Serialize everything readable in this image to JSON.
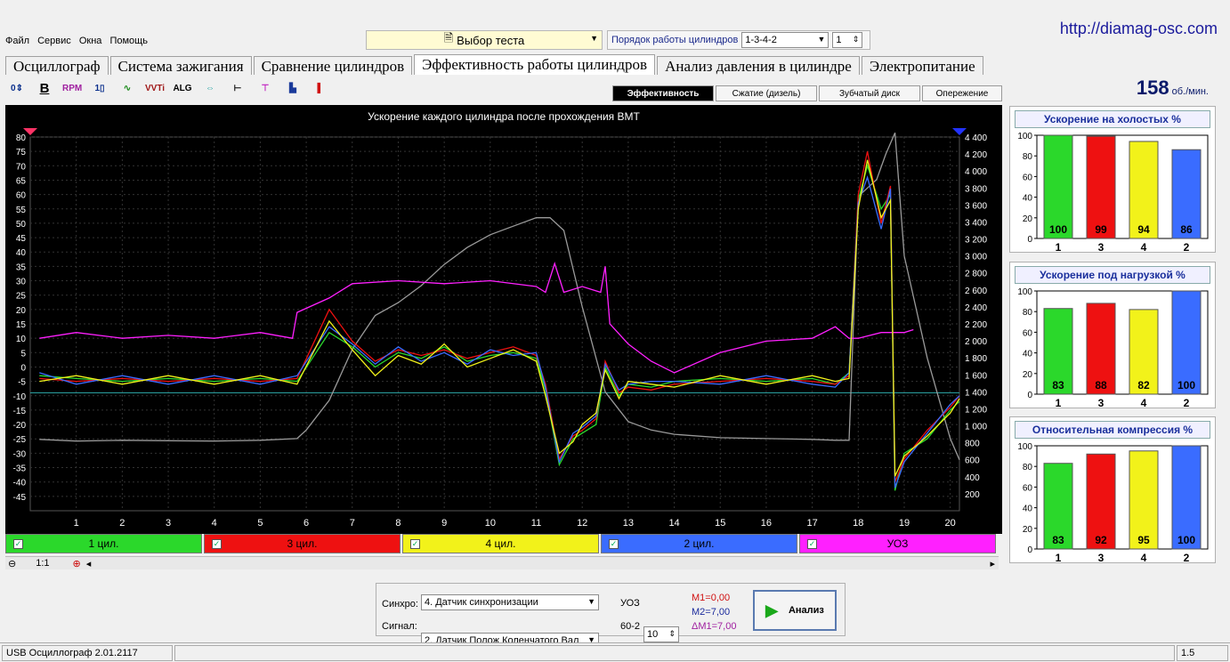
{
  "site_url": "http://diamag-osc.com",
  "menu": [
    "Файл",
    "Сервис",
    "Окна",
    "Помощь"
  ],
  "test_select": {
    "value": "Выбор теста"
  },
  "cyl_order": {
    "label": "Порядок работы цилиндров",
    "value": "1-3-4-2",
    "num": "1"
  },
  "tabs": [
    "Осциллограф",
    "Система зажигания",
    "Сравнение цилиндров",
    "Эффективность работы цилиндров",
    "Анализ давления в цилиндре",
    "Электропитание"
  ],
  "active_tab": 3,
  "subtabs": [
    "Эффективность",
    "Сжатие (дизель)",
    "Зубчатый диск",
    "Опережение"
  ],
  "rpm": {
    "value": "158",
    "unit": "об./мин."
  },
  "chart_title": "Ускорение каждого цилиндра после прохождения ВМТ",
  "colors": {
    "cyl1": "#2bd82b",
    "cyl3": "#ee1111",
    "cyl4": "#f2f21a",
    "cyl2": "#3a6cff",
    "uoz": "#ff20ff",
    "gray": "#9a9a9a",
    "ref": "#2aa0a0"
  },
  "legend": [
    {
      "label": "1 цил.",
      "color": "#2bd82b"
    },
    {
      "label": "3 цил.",
      "color": "#ee1111"
    },
    {
      "label": "4 цил.",
      "color": "#f2f21a"
    },
    {
      "label": "2 цил.",
      "color": "#3a6cff"
    },
    {
      "label": "УОЗ",
      "color": "#ff20ff"
    }
  ],
  "zoom_label": "1:1",
  "chart_data": {
    "type": "line",
    "title": "Ускорение каждого цилиндра после прохождения ВМТ",
    "x_ticks": [
      1,
      2,
      3,
      4,
      5,
      6,
      7,
      8,
      9,
      10,
      11,
      12,
      13,
      14,
      15,
      16,
      17,
      18,
      19,
      20
    ],
    "y_left_ticks": [
      80,
      75,
      70,
      65,
      60,
      55,
      50,
      45,
      40,
      35,
      30,
      25,
      20,
      15,
      10,
      5,
      0,
      -5,
      -10,
      -15,
      -20,
      -25,
      -30,
      -35,
      -40,
      -45
    ],
    "y_right_ticks": [
      "4 400",
      "4 200",
      "4 000",
      "3 800",
      "3 600",
      "3 400",
      "3 200",
      "3 000",
      "2 800",
      "2 600",
      "2 400",
      "2 200",
      "2 000",
      "1 800",
      "1 600",
      "1 400",
      "1 200",
      "1 000",
      "800",
      "600",
      "400",
      "200"
    ],
    "xlim": [
      0,
      20.2
    ],
    "ylim_left": [
      -50,
      80
    ],
    "ylim_right": [
      0,
      4400
    ],
    "reference_y": -9,
    "series": [
      {
        "name": "1 цил.",
        "axis": "left",
        "color": "#2bd82b",
        "x": [
          0.2,
          1,
          2,
          3,
          4,
          5,
          5.8,
          6.5,
          7,
          7.5,
          8,
          8.5,
          9,
          9.5,
          10,
          10.5,
          11,
          11.2,
          11.5,
          11.8,
          12,
          12.3,
          12.5,
          12.8,
          13,
          13.5,
          14,
          15,
          16,
          17,
          17.5,
          17.8,
          18,
          18.2,
          18.5,
          18.7,
          18.8,
          19,
          19.5,
          20,
          20.2
        ],
        "y": [
          -3,
          -4,
          -5,
          -4,
          -5,
          -4,
          -5,
          12,
          7,
          0,
          5,
          3,
          7,
          2,
          4,
          5,
          3,
          -8,
          -34,
          -25,
          -23,
          -20,
          0,
          -10,
          -6,
          -7,
          -5,
          -4,
          -5,
          -4,
          -6,
          -2,
          58,
          70,
          55,
          60,
          -43,
          -30,
          -25,
          -15,
          -12
        ]
      },
      {
        "name": "3 цил.",
        "axis": "left",
        "color": "#ee1111",
        "x": [
          0.2,
          1,
          2,
          3,
          4,
          5,
          5.8,
          6.5,
          7,
          7.5,
          8,
          8.5,
          9,
          9.5,
          10,
          10.5,
          11,
          11.2,
          11.5,
          11.8,
          12,
          12.3,
          12.5,
          12.8,
          13,
          13.5,
          14,
          15,
          16,
          17,
          17.5,
          17.8,
          18,
          18.2,
          18.5,
          18.7,
          18.8,
          19,
          19.5,
          20,
          20.2
        ],
        "y": [
          -4,
          -5,
          -4,
          -5,
          -4,
          -5,
          -4,
          20,
          9,
          2,
          6,
          4,
          6,
          3,
          5,
          7,
          4,
          -6,
          -32,
          -24,
          -22,
          -18,
          2,
          -9,
          -7,
          -8,
          -6,
          -5,
          -4,
          -5,
          -6,
          -3,
          60,
          75,
          50,
          63,
          -40,
          -32,
          -22,
          -14,
          -10
        ]
      },
      {
        "name": "4 цил.",
        "axis": "left",
        "color": "#f2f21a",
        "x": [
          0.2,
          1,
          2,
          3,
          4,
          5,
          5.8,
          6.5,
          7,
          7.5,
          8,
          8.5,
          9,
          9.5,
          10,
          10.5,
          11,
          11.2,
          11.5,
          11.8,
          12,
          12.3,
          12.5,
          12.8,
          13,
          13.5,
          14,
          15,
          16,
          17,
          17.5,
          17.8,
          18,
          18.2,
          18.5,
          18.7,
          18.8,
          19,
          19.5,
          20,
          20.2
        ],
        "y": [
          -5,
          -3,
          -6,
          -3,
          -6,
          -3,
          -6,
          16,
          6,
          -3,
          4,
          1,
          8,
          0,
          3,
          6,
          2,
          -10,
          -30,
          -26,
          -20,
          -16,
          -1,
          -11,
          -5,
          -6,
          -7,
          -3,
          -6,
          -3,
          -5,
          -4,
          55,
          72,
          52,
          58,
          -38,
          -31,
          -24,
          -16,
          -11
        ]
      },
      {
        "name": "2 цил.",
        "axis": "left",
        "color": "#3a6cff",
        "x": [
          0.2,
          1,
          2,
          3,
          4,
          5,
          5.8,
          6.5,
          7,
          7.5,
          8,
          8.5,
          9,
          9.5,
          10,
          10.5,
          11,
          11.2,
          11.5,
          11.8,
          12,
          12.3,
          12.5,
          12.8,
          13,
          13.5,
          14,
          15,
          16,
          17,
          17.5,
          17.8,
          18,
          18.2,
          18.5,
          18.7,
          18.8,
          19,
          19.5,
          20,
          20.2
        ],
        "y": [
          -2,
          -6,
          -3,
          -6,
          -3,
          -6,
          -3,
          14,
          8,
          1,
          7,
          2,
          5,
          1,
          6,
          4,
          5,
          -7,
          -33,
          -23,
          -21,
          -17,
          1,
          -8,
          -6,
          -5,
          -5,
          -6,
          -3,
          -6,
          -7,
          -2,
          57,
          66,
          48,
          62,
          -42,
          -33,
          -23,
          -13,
          -10
        ]
      },
      {
        "name": "УОЗ",
        "axis": "left",
        "color": "#ff20ff",
        "x": [
          0.2,
          1,
          2,
          3,
          4,
          5,
          5.7,
          5.8,
          6.5,
          7,
          8,
          9,
          10,
          11,
          11.2,
          11.4,
          11.6,
          12,
          12.4,
          12.5,
          12.6,
          13,
          13.5,
          14,
          15,
          16,
          17,
          17.5,
          17.8,
          18,
          18.5,
          19,
          19.2
        ],
        "y": [
          10,
          12,
          10,
          11,
          10,
          12,
          10,
          19,
          24,
          29,
          30,
          29,
          30,
          28,
          26,
          36,
          26,
          28,
          26,
          35,
          15,
          8,
          2,
          -2,
          5,
          9,
          10,
          14,
          10,
          10,
          12,
          12,
          13
        ]
      },
      {
        "name": "gray",
        "axis": "right",
        "color": "#9a9a9a",
        "x": [
          0.2,
          1,
          2,
          3,
          4,
          5,
          5.8,
          6,
          6.5,
          7,
          7.5,
          8,
          8.5,
          9,
          9.5,
          10,
          10.5,
          11,
          11.3,
          11.6,
          12,
          12.5,
          13,
          13.5,
          14,
          15,
          16,
          17,
          17.5,
          17.8,
          18,
          18.2,
          18.4,
          18.6,
          18.8,
          19,
          19.5,
          20,
          20.2
        ],
        "y": [
          840,
          820,
          830,
          825,
          820,
          830,
          850,
          950,
          1300,
          1900,
          2300,
          2450,
          2650,
          2900,
          3100,
          3250,
          3350,
          3450,
          3450,
          3300,
          2400,
          1400,
          1050,
          950,
          900,
          860,
          850,
          840,
          830,
          830,
          3700,
          3800,
          3900,
          4200,
          4450,
          3000,
          1800,
          850,
          600
        ]
      }
    ]
  },
  "panels": [
    {
      "title": "Ускорение на холостых %",
      "categories": [
        "1",
        "3",
        "4",
        "2"
      ],
      "values": [
        100,
        99,
        94,
        86
      ],
      "colors": [
        "#2bd82b",
        "#ee1111",
        "#f2f21a",
        "#3a6cff"
      ],
      "y_ticks": [
        "0",
        "20",
        "40",
        "60",
        "80",
        "100"
      ]
    },
    {
      "title": "Ускорение под нагрузкой %",
      "categories": [
        "1",
        "3",
        "4",
        "2"
      ],
      "values": [
        83,
        88,
        82,
        100
      ],
      "colors": [
        "#2bd82b",
        "#ee1111",
        "#f2f21a",
        "#3a6cff"
      ],
      "y_ticks": [
        "0",
        "20",
        "40",
        "60",
        "80",
        "100"
      ]
    },
    {
      "title": "Относительная компрессия %",
      "categories": [
        "1",
        "3",
        "4",
        "2"
      ],
      "values": [
        83,
        92,
        95,
        100
      ],
      "colors": [
        "#2bd82b",
        "#ee1111",
        "#f2f21a",
        "#3a6cff"
      ],
      "y_ticks": [
        "0",
        "20",
        "40",
        "60",
        "80",
        "100"
      ]
    }
  ],
  "controls": {
    "sync_label": "Синхро:",
    "sync_value": "4.  Датчик синхронизации",
    "signal_label": "Сигнал:",
    "signal_value": "2.  Датчик Полож Коленчатого Вал",
    "uoz_label": "УОЗ",
    "uoz_value": "10",
    "uoz_sub": "60-2",
    "m1": "M1=0,00",
    "m2": "M2=7,00",
    "dm": "ΔM1=7,00",
    "analyze_label": "Анализ"
  },
  "status": {
    "left": "USB Осциллограф  2.01.2117",
    "right": "1.5"
  }
}
